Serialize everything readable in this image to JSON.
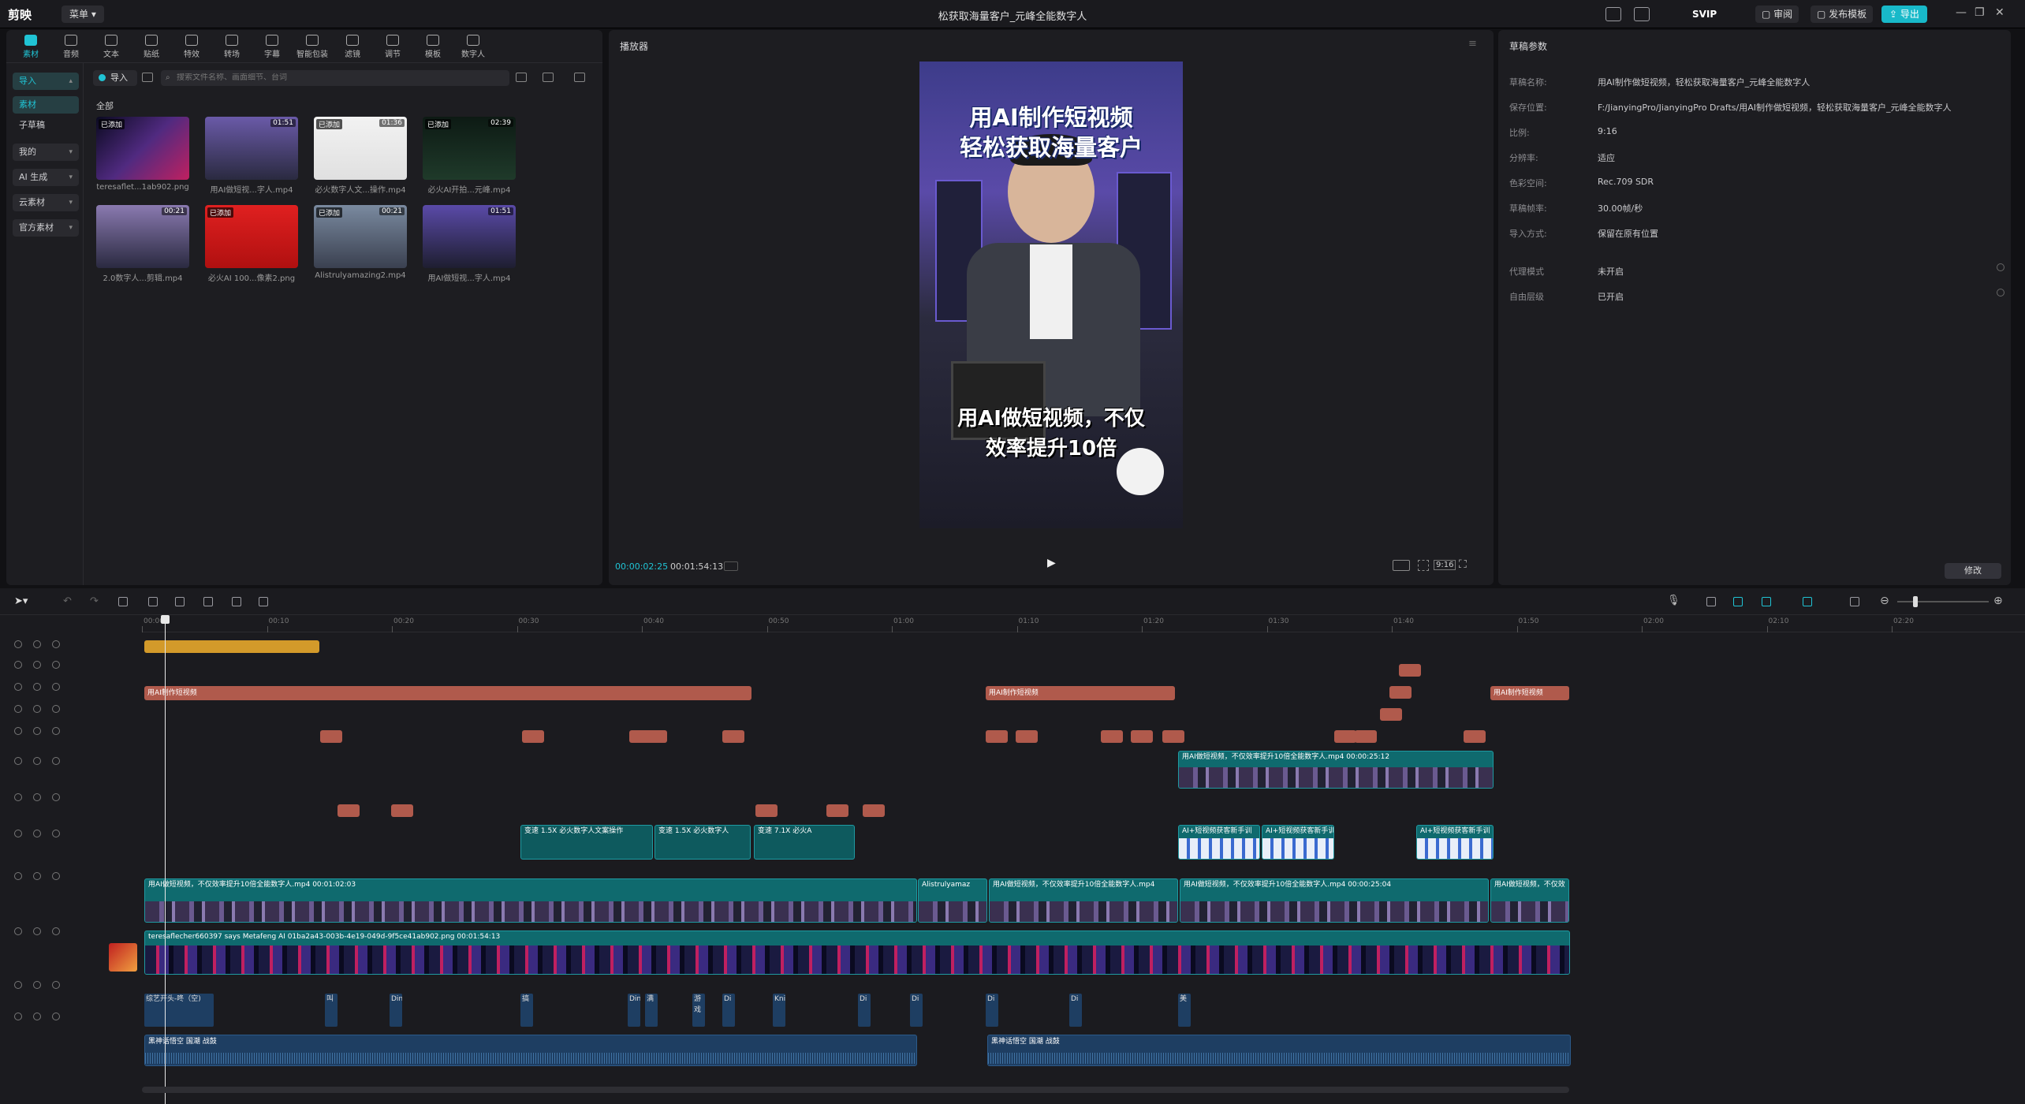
{
  "titlebar": {
    "app_name": "剪映",
    "menu_label": "菜单",
    "doc_title": "松获取海量客户_元峰全能数字人",
    "svip": "SVIP",
    "review_label": "审阅",
    "publish_template_label": "发布模板",
    "export_label": "导出"
  },
  "media_tools": [
    {
      "label": "素材",
      "icon": "media-icon",
      "active": true
    },
    {
      "label": "音频",
      "icon": "audio-icon"
    },
    {
      "label": "文本",
      "icon": "text-icon"
    },
    {
      "label": "贴纸",
      "icon": "sticker-icon"
    },
    {
      "label": "特效",
      "icon": "effects-icon"
    },
    {
      "label": "转场",
      "icon": "transition-icon"
    },
    {
      "label": "字幕",
      "icon": "subtitle-icon"
    },
    {
      "label": "智能包装",
      "icon": "smart-pack-icon"
    },
    {
      "label": "滤镜",
      "icon": "filter-icon"
    },
    {
      "label": "调节",
      "icon": "adjust-icon"
    },
    {
      "label": "模板",
      "icon": "template-icon"
    },
    {
      "label": "数字人",
      "icon": "avatar-icon"
    }
  ],
  "sidebar": [
    {
      "label": "导入",
      "type": "drop",
      "selected": true
    },
    {
      "label": "素材",
      "type": "item",
      "selected": true
    },
    {
      "label": "子草稿",
      "type": "item"
    },
    {
      "label": "我的",
      "type": "drop"
    },
    {
      "label": "AI 生成",
      "type": "drop"
    },
    {
      "label": "云素材",
      "type": "drop"
    },
    {
      "label": "官方素材",
      "type": "drop"
    }
  ],
  "media": {
    "import_label": "导入",
    "search_placeholder": "搜索文件名称、画面细节、台词",
    "all_label": "全部",
    "added_label": "已添加",
    "items": [
      {
        "name": "teresaflet...1ab902.png",
        "duration": "",
        "added": true
      },
      {
        "name": "用AI做短视...字人.mp4",
        "duration": "01:51",
        "added": false
      },
      {
        "name": "必火数字人文...操作.mp4",
        "duration": "01:36",
        "added": true
      },
      {
        "name": "必火AI开拍...元峰.mp4",
        "duration": "02:39",
        "added": true
      },
      {
        "name": "2.0数字人...剪辑.mp4",
        "duration": "00:21",
        "added": false
      },
      {
        "name": "必火AI 100...像素2.png",
        "duration": "",
        "added": true
      },
      {
        "name": "Alistrulyamazing2.mp4",
        "duration": "00:21",
        "added": true
      },
      {
        "name": "用AI做短视...字人.mp4",
        "duration": "01:51",
        "added": false
      }
    ]
  },
  "player": {
    "title": "播放器",
    "current_time": "00:00:02:25",
    "total_time": "00:01:54:13",
    "ratio_label": "9:16",
    "video_title_line1": "用AI制作短视频",
    "video_title_line2": "轻松获取海量客户",
    "video_caption_line1": "用AI做短视频，不仅",
    "video_caption_line2": "效率提升10倍"
  },
  "props": {
    "title": "草稿参数",
    "rows": [
      {
        "k": "草稿名称:",
        "v": "用AI制作做短视频，轻松获取海量客户_元峰全能数字人"
      },
      {
        "k": "保存位置:",
        "v": "F:/JianyingPro/JianyingPro Drafts/用AI制作做短视频，轻松获取海量客户_元峰全能数字人"
      },
      {
        "k": "比例:",
        "v": "9:16"
      },
      {
        "k": "分辨率:",
        "v": "适应"
      },
      {
        "k": "色彩空间:",
        "v": "Rec.709 SDR"
      },
      {
        "k": "草稿帧率:",
        "v": "30.00帧/秒"
      },
      {
        "k": "导入方式:",
        "v": "保留在原有位置"
      },
      {
        "k": "代理模式",
        "v": "未开启"
      },
      {
        "k": "自由层级",
        "v": "已开启"
      }
    ],
    "modify_label": "修改"
  },
  "timeline": {
    "ruler_labels": [
      "00:00",
      "00:10",
      "00:20",
      "00:30",
      "00:40",
      "00:50",
      "01:00",
      "01:10",
      "01:20",
      "01:30",
      "01:40",
      "01:50",
      "02:00",
      "02:10",
      "02:20"
    ],
    "text_clip_label": "用AI制作短视频",
    "video_main_label": "用AI做短视频，不仅效率提升10倍全能数字人.mp4   00:01:02:03",
    "video_main_label2": "用AI做短视频，不仅效率提升10倍全能数字人.mp4",
    "video_main_label3": "用AI做短视频，不仅效率提升10倍全能数字人.mp4   00:00:25:04",
    "video_main_label4": "用AI做短视频，不仅效",
    "video_mid_label": "用AI做短视频，不仅效率提升10倍全能数字人.mp4   00:00:25:12",
    "alist_label": "Alistrulyamaz",
    "speed_clip1": "变速 1.5X  必火数字人文案操作",
    "speed_clip2": "变速 1.5X  必火数字人",
    "speed_clip3": "变速 7.1X  必火A",
    "ai_clip_label": "AI+短视频获客新手训",
    "bg_label": "teresaflecher660397 says Metafeng AI 01ba2a43-003b-4e19-049d-9f5ce41ab902.png   00:01:54:13",
    "audio_label1": "黑神话悟空 国潮 战鼓",
    "audio_label2": "黑神话悟空 国潮 战鼓",
    "sfx_label": "综艺开头-咚（空)",
    "sfx_small": [
      "叫",
      "Din",
      "搞",
      "Din",
      "满",
      "游戏",
      "Di",
      "Knif",
      "Di",
      "Di",
      "Di",
      "Di",
      "美"
    ]
  }
}
